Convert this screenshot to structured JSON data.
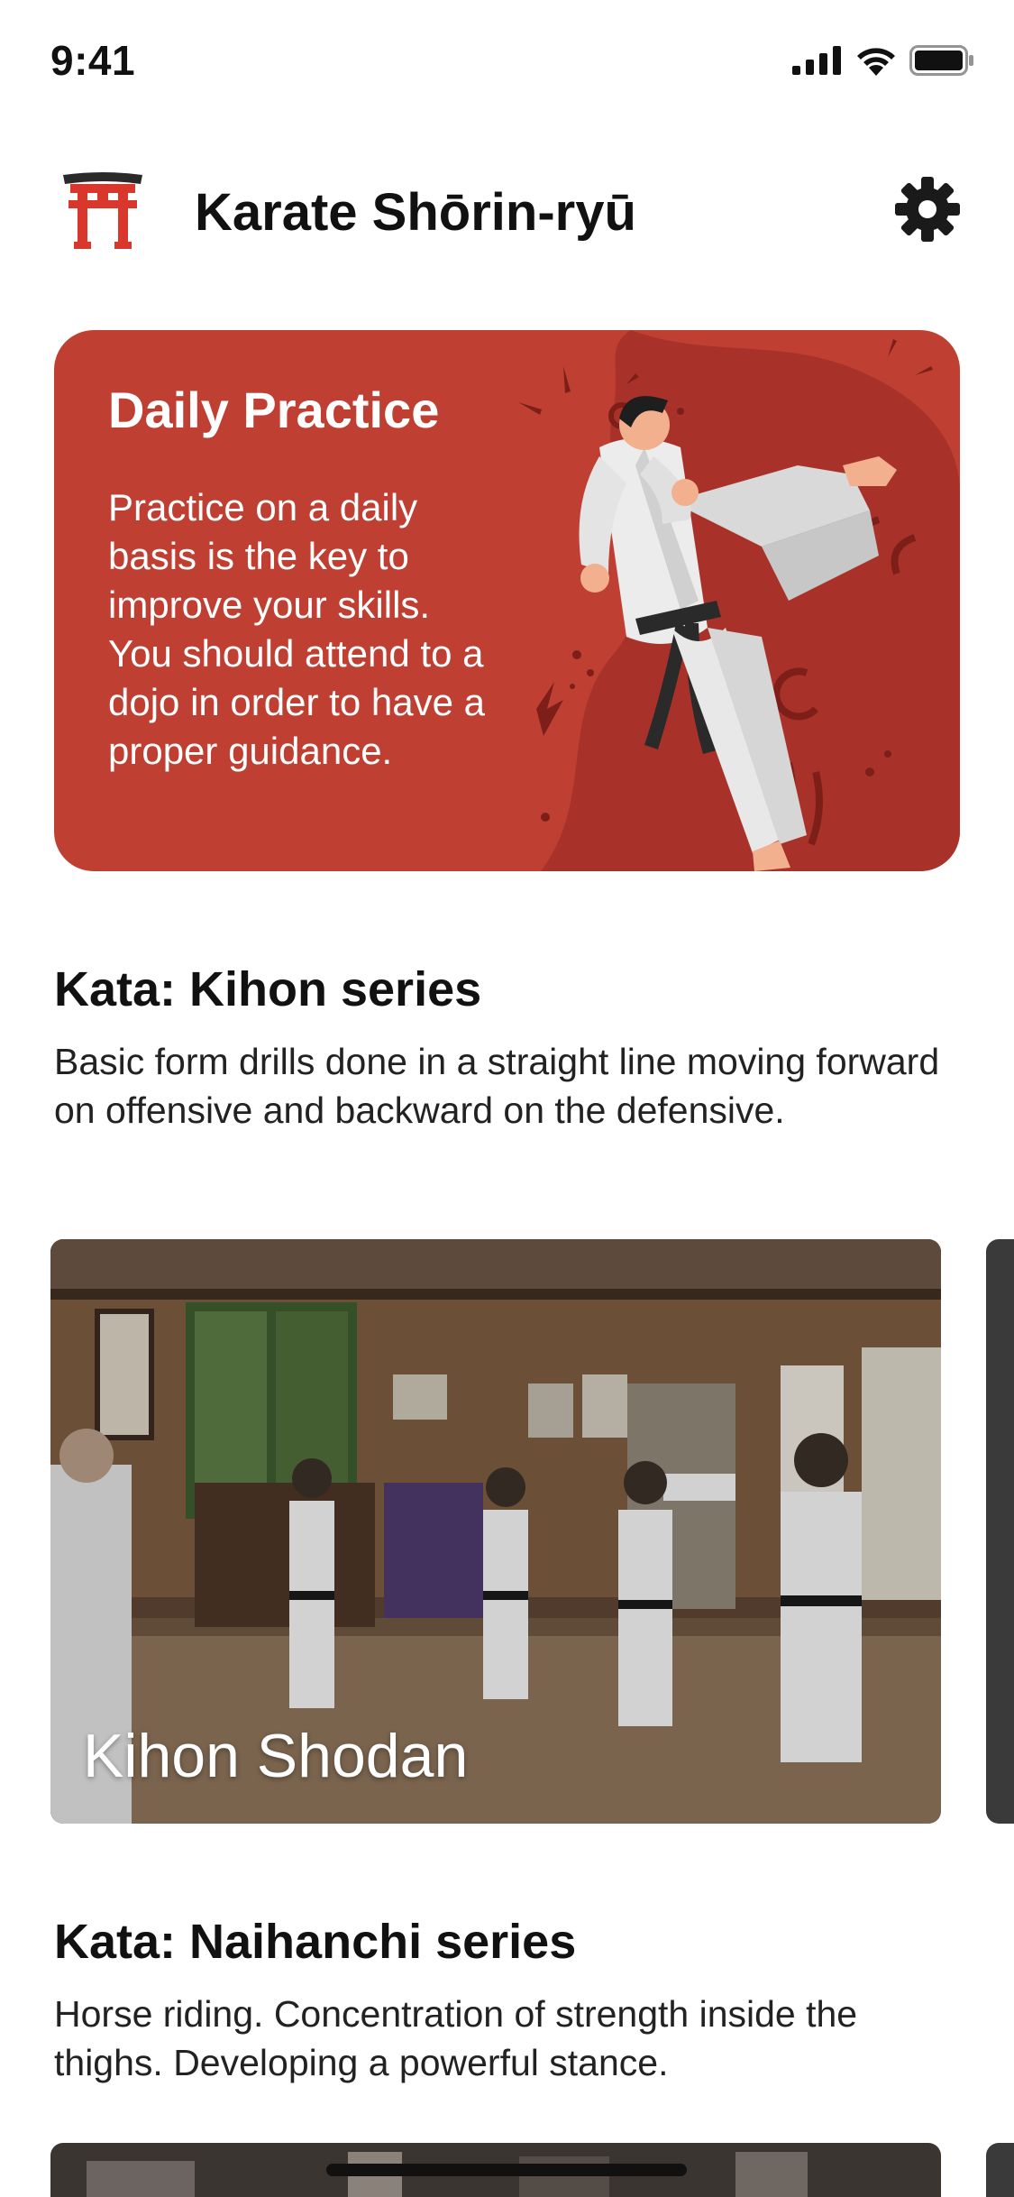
{
  "status_bar": {
    "time": "9:41",
    "icons": [
      "cellular-signal-icon",
      "wifi-icon",
      "battery-icon"
    ]
  },
  "header": {
    "logo_icon": "torii-gate-icon",
    "title": "Karate Shōrin-ryū",
    "settings_icon": "gear-icon"
  },
  "practice_card": {
    "title": "Daily Practice",
    "text": "Practice on a daily basis is the key to improve your skills. You should attend to a dojo in order to have a proper guidance.",
    "background_color": "#bf4033",
    "illustration": "karate-kick-illustration"
  },
  "sections": [
    {
      "title": "Kata: Kihon series",
      "description": "Basic form drills done in a straight line moving forward on offensive and backward on the defensive.",
      "videos": [
        {
          "label": "Kihon Shodan",
          "thumbnail": "dojo-kata-practice-photo"
        }
      ]
    },
    {
      "title": "Kata: Naihanchi series",
      "description": "Horse riding. Concentration of strength inside the thighs. Developing a powerful stance.",
      "videos": [
        {
          "label": "",
          "thumbnail": "dojo-photo"
        }
      ]
    }
  ],
  "colors": {
    "accent": "#bf4033",
    "accent_dark": "#a8322a",
    "text": "#111111",
    "logo": "#d9372b"
  }
}
